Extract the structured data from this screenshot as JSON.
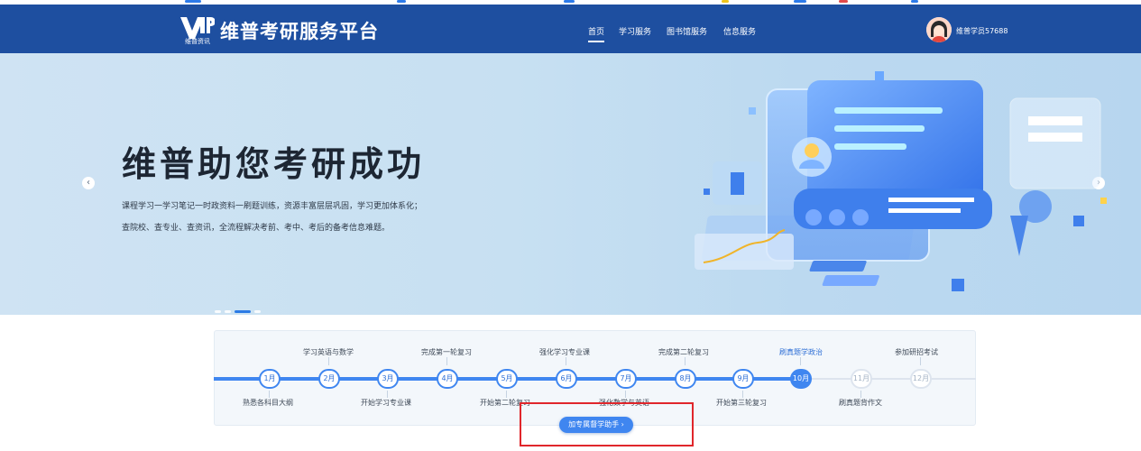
{
  "header": {
    "logo_text": "VIP",
    "logo_sub": "维普资讯",
    "brand": "维普考研服务平台",
    "nav": [
      {
        "label": "首页",
        "active": true
      },
      {
        "label": "学习服务",
        "active": false
      },
      {
        "label": "图书馆服务",
        "active": false
      },
      {
        "label": "信息服务",
        "active": false
      }
    ],
    "username": "维普学员57688",
    "bg_color": "#1e4fa0"
  },
  "banner": {
    "headline": "维普助您考研成功",
    "desc_line1": "课程学习一学习笔记一时政资料一刷题训练，资源丰富层层巩固，学习更加体系化；",
    "desc_line2": "查院校、查专业、查资讯，全流程解决考前、考中、考后的备考信息难题。",
    "prev_arrow": "‹",
    "next_arrow": "›",
    "slides_total": 4,
    "slide_active": 3
  },
  "timeline": {
    "months": [
      "1月",
      "2月",
      "3月",
      "4月",
      "5月",
      "6月",
      "7月",
      "8月",
      "9月",
      "10月",
      "11月",
      "12月"
    ],
    "current_month_index": 9,
    "top_events": [
      "学习英语与数学",
      "完成第一轮复习",
      "强化学习专业课",
      "完成第二轮复习",
      "刷真题学政治",
      "参加研招考试"
    ],
    "bottom_events": [
      "熟悉各科目大纲",
      "开始学习专业课",
      "开始第二轮复习",
      "强化数学与英语",
      "开始第三轮复习",
      "刷真题背作文"
    ],
    "cta_label": "加专属督学助手 ›",
    "accent": "#3f86f0"
  }
}
